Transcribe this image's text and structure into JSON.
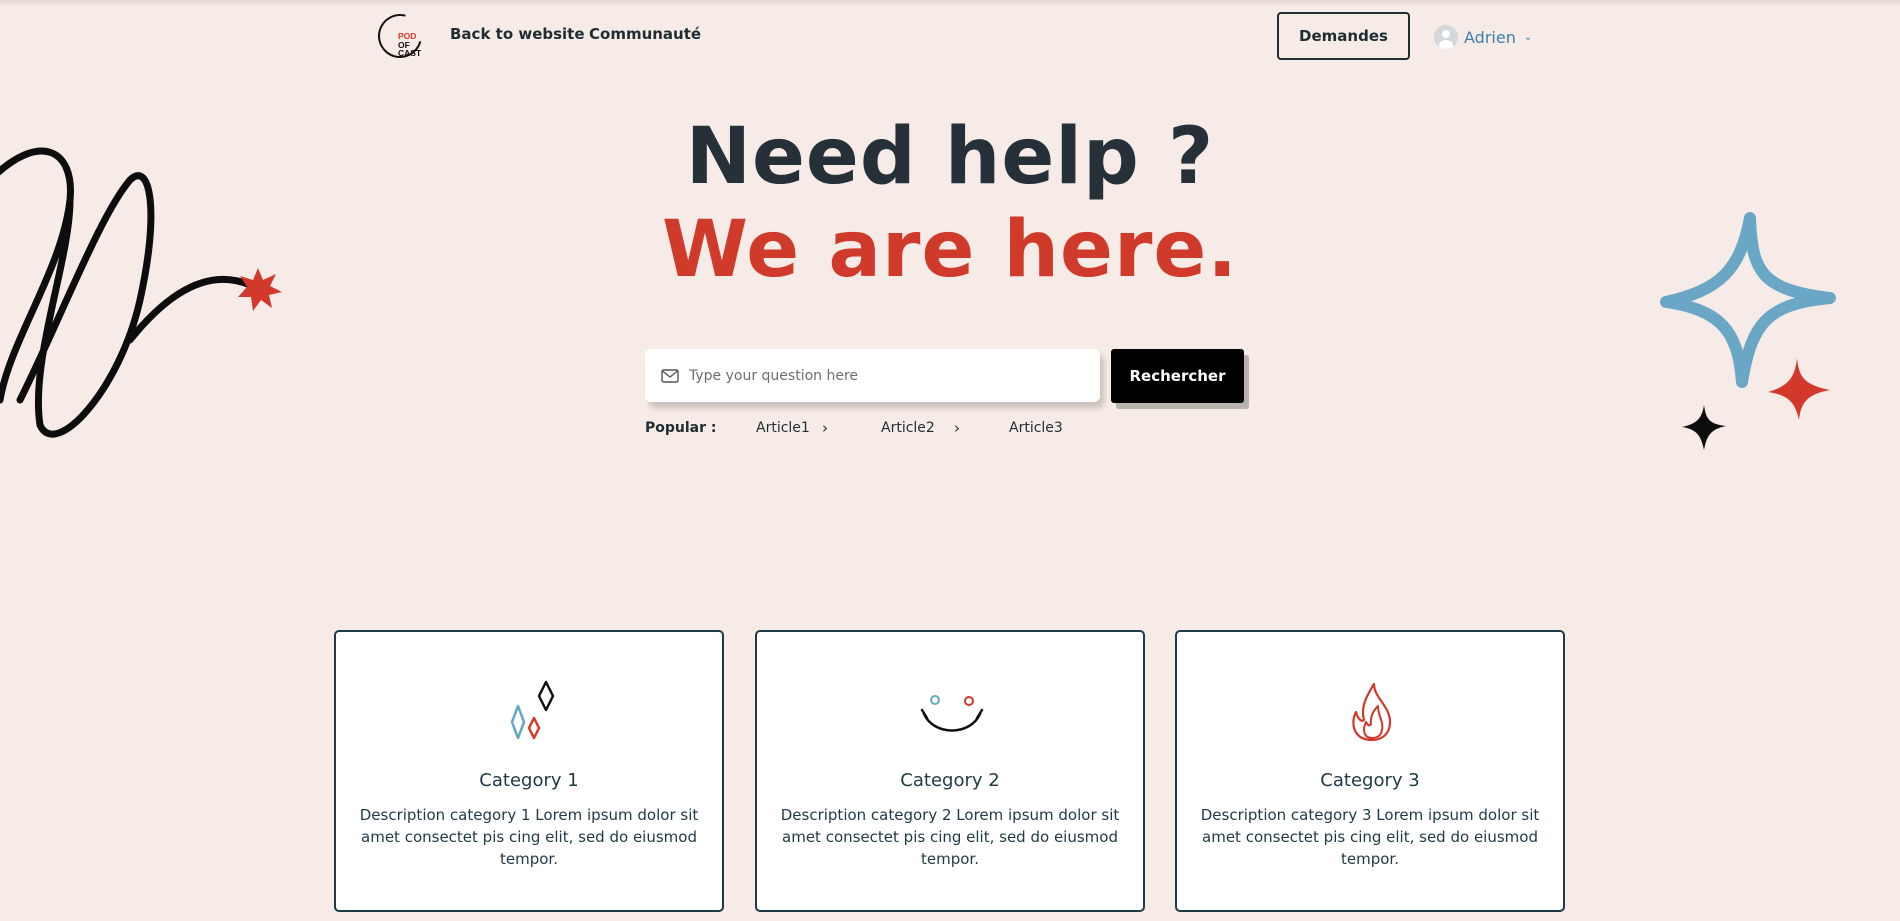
{
  "header": {
    "logo": {
      "line1": "POD",
      "line2": "OF",
      "line3": "CAST"
    },
    "nav": [
      {
        "label": "Back to website"
      },
      {
        "label": "Communauté"
      }
    ],
    "requests_button": "Demandes",
    "user_name": "Adrien",
    "user_icon": "avatar-icon",
    "chevron_icon": "chevron-down-icon"
  },
  "hero": {
    "title_line1": "Need help ?",
    "title_line2": "We are here.",
    "search": {
      "placeholder": "Type your question here",
      "icon": "mail-icon",
      "button_label": "Rechercher"
    },
    "popular": {
      "label": "Popular :",
      "articles": [
        {
          "label": "Article1"
        },
        {
          "label": "Article2"
        },
        {
          "label": "Article3"
        }
      ]
    }
  },
  "categories": [
    {
      "title": "Category 1",
      "description": "Description category 1 Lorem ipsum dolor sit amet consectet pis cing elit, sed do eiusmod tempor.",
      "icon": "sparkles-icon"
    },
    {
      "title": "Category 2",
      "description": "Description category 2 Lorem ipsum dolor sit amet consectet pis cing elit, sed do eiusmod tempor.",
      "icon": "smiley-icon"
    },
    {
      "title": "Category 3",
      "description": "Description category 3 Lorem ipsum dolor sit amet consectet pis cing elit, sed do eiusmod tempor.",
      "icon": "flame-icon"
    }
  ],
  "colors": {
    "background": "#f6ebe6",
    "accent_red": "#cf3a2b",
    "accent_blue": "#6aa6c6",
    "dark": "#253038"
  }
}
